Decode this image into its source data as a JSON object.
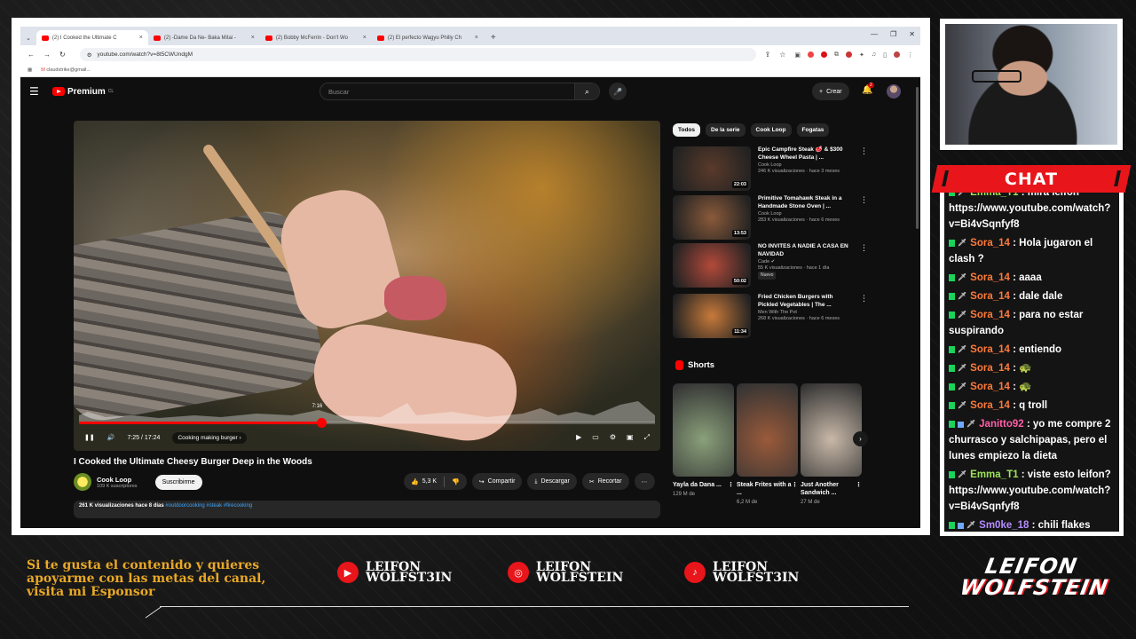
{
  "browser": {
    "tabs": [
      {
        "label": "(2) I Cooked the Ultimate C",
        "active": true
      },
      {
        "label": "(2) -Dame Da Ne- Baka Mitai -",
        "active": false
      },
      {
        "label": "(2) Bobby McFerrin - Don't Wo",
        "active": false
      },
      {
        "label": "(2) El perfecto Wagyu Philly Ch",
        "active": false
      }
    ],
    "url": "youtube.com/watch?v=8t5CWUndgM",
    "bookmark": "claudstrike@gmail..."
  },
  "youtube": {
    "logo": "Premium",
    "logo_region": "CL",
    "search_placeholder": "Buscar",
    "create_label": "Crear",
    "notif_count": "2",
    "player": {
      "time": "7:25 / 17:24",
      "chapter": "Cooking making burger",
      "hover_time": "7:16",
      "progress": 0.42
    },
    "video_title": "I Cooked the Ultimate Cheesy Burger Deep in the Woods",
    "channel": {
      "name": "Cook Loop",
      "subs": "109 K suscriptores",
      "subscribe": "Suscribirme"
    },
    "actions": {
      "likes": "5,3 K",
      "share": "Compartir",
      "download": "Descargar",
      "clip": "Recortar"
    },
    "description": {
      "meta": "261 K visualizaciones  hace 8 días",
      "tags": "#outdoorcooking #steak #firecooking"
    },
    "chips": [
      "Todos",
      "De la serie",
      "Cook Loop",
      "Fogatas"
    ],
    "recommended": [
      {
        "title": "Epic Campfire Steak 🥩 & $300 Cheese Wheel Pasta | ...",
        "channel": "Cook Loop",
        "meta": "246 K visualizaciones · hace 3 meses",
        "duration": "22:03",
        "color": "#5a3a2a"
      },
      {
        "title": "Primitive Tomahawk Steak in a Handmade Stone Oven | ...",
        "channel": "Cook Loop",
        "meta": "283 K visualizaciones · hace 6 meses",
        "duration": "13:53",
        "color": "#8a5a3a"
      },
      {
        "title": "NO INVITES A NADIE A CASA EN NAVIDAD",
        "channel": "Cade ✔",
        "meta": "55 K visualizaciones · hace 1 día",
        "badge": "Nuevo",
        "duration": "50:02",
        "color": "#b24a3a"
      },
      {
        "title": "Fried Chicken Burgers with Pickled Vegetables | The ...",
        "channel": "Men With The Pot",
        "meta": "268 K visualizaciones · hace 6 meses",
        "duration": "11:34",
        "color": "#c87a3a"
      }
    ],
    "shorts_label": "Shorts",
    "shorts": [
      {
        "title": "Yayla da Dana ...",
        "views": "129 M de",
        "color": "#8aa07a"
      },
      {
        "title": "Steak Frites with a ...",
        "views": "6,2 M de",
        "color": "#9a5a3a"
      },
      {
        "title": "Just Another Sandwich ...",
        "views": "27 M de",
        "color": "#c8b8a8"
      }
    ]
  },
  "chat": {
    "title": "CHAT",
    "messages": [
      {
        "user": "Emma_T1",
        "text": " : mira leifon https://www.youtube.com/watch?v=Bi4vSqnfyf8",
        "color": "#9ee35a"
      },
      {
        "user": "Sora_14",
        "text": " : Hola jugaron el clash ?",
        "color": "#ff7a3a"
      },
      {
        "user": "Sora_14",
        "text": " : aaaa",
        "color": "#ff7a3a"
      },
      {
        "user": "Sora_14",
        "text": " : dale dale",
        "color": "#ff7a3a"
      },
      {
        "user": "Sora_14",
        "text": " : para no estar suspirando",
        "color": "#ff7a3a"
      },
      {
        "user": "Sora_14",
        "text": " : entiendo",
        "color": "#ff7a3a"
      },
      {
        "user": "Sora_14",
        "text": " : 🐢",
        "color": "#ff7a3a"
      },
      {
        "user": "Sora_14",
        "text": " : 🐢",
        "color": "#ff7a3a"
      },
      {
        "user": "Sora_14",
        "text": " : q troll",
        "color": "#ff7a3a"
      },
      {
        "user": "Janitto92",
        "text": " : yo me compre 2 churrasco y salchipapas, pero el lunes empiezo la dieta",
        "color": "#ff5fa8"
      },
      {
        "user": "Emma_T1",
        "text": " : viste esto leifon? https://www.youtube.com/watch?v=Bi4vSqnfyf8",
        "color": "#9ee35a"
      },
      {
        "user": "Sm0ke_18",
        "text": " : chili flakes",
        "color": "#b58cff"
      }
    ]
  },
  "footer": {
    "sponsor": "Si te gusta el contenido y quieres apoyarme con las metas del canal, visita mi Esponsor",
    "socials": [
      {
        "icon": "youtube-icon",
        "line1": "LEIFON",
        "line2": "WOLFST3IN"
      },
      {
        "icon": "instagram-icon",
        "line1": "LEIFON",
        "line2": "WOLFSTEIN"
      },
      {
        "icon": "tiktok-icon",
        "line1": "LEIFON",
        "line2": "WOLFST3IN"
      }
    ],
    "brand_l1": "LEIFON",
    "brand_l2": "WOLFSTEIN"
  }
}
